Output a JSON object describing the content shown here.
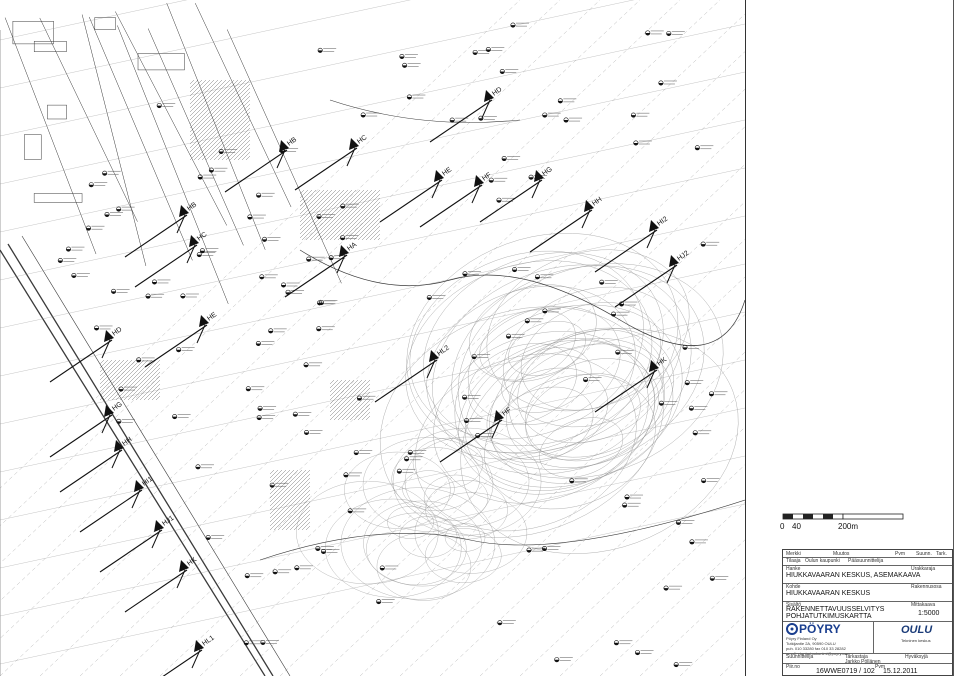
{
  "map": {
    "section_markers": [
      {
        "id": "HD",
        "angle": -35
      },
      {
        "id": "HB",
        "angle": -35
      },
      {
        "id": "HC",
        "angle": -35
      },
      {
        "id": "HE",
        "angle": -35
      },
      {
        "id": "HF",
        "angle": -35
      },
      {
        "id": "HG",
        "angle": -35
      },
      {
        "id": "HH",
        "angle": -35
      },
      {
        "id": "HI2",
        "angle": -35
      },
      {
        "id": "HJ2",
        "angle": -35
      },
      {
        "id": "HA",
        "angle": -35
      },
      {
        "id": "HB",
        "angle": -35
      },
      {
        "id": "HC",
        "angle": -35
      },
      {
        "id": "HE",
        "angle": -35
      },
      {
        "id": "HD",
        "angle": -35
      },
      {
        "id": "HL2",
        "angle": -35
      },
      {
        "id": "HK",
        "angle": -35
      },
      {
        "id": "HF",
        "angle": -35
      },
      {
        "id": "HG",
        "angle": -35
      },
      {
        "id": "HH",
        "angle": -35
      },
      {
        "id": "HI1",
        "angle": -35
      },
      {
        "id": "HJ1",
        "angle": -35
      },
      {
        "id": "HK",
        "angle": -35
      },
      {
        "id": "HL1",
        "angle": -35
      }
    ],
    "feature_colors": {
      "linework": "#3a3a3a",
      "contour": "#8a8a8a",
      "hatch": "#555555"
    }
  },
  "scale": {
    "labels": [
      "0",
      "40",
      "200m"
    ]
  },
  "title_block": {
    "header_cells": [
      "Merkki",
      "Muutos",
      "Pvm",
      "Suunn.",
      "Tark."
    ],
    "row2": [
      "Tilaaja",
      "Oulun kaupunki",
      "Pääsuunnittelija"
    ],
    "project_label": "Hanke",
    "project_name": "HIUKKAVAARAN KESKUS, ASEMAKAAVA",
    "area_label": "Kohde",
    "area_name": "HIUKKAVAARAN KESKUS",
    "content_label": "Sisältö",
    "content_line1": "RAKENNETTAVUUSSELVITYS",
    "content_line2": "POHJATUTKIMUSKARTTA",
    "scale_label": "Mittakaava",
    "scale_value": "1:5000",
    "right_labels": [
      "Urakkaraja",
      "Rakennusosa",
      "Piirustuksen numero"
    ],
    "company_name": "PÖYRY",
    "company_sub1": "Pöyry Finland Oy",
    "company_sub2": "Tutkijantie 2A, 90590 OULU",
    "company_sub3": "puh. 010 33280  fax 010 33 28282",
    "company_sub4": "email: etunimi.sukunimi@poyry.com",
    "client_logo": "OULU",
    "client_sub": "Tekninen keskus",
    "bottom_labels": [
      "Suunnittelija",
      "Tarkastaja",
      "Hyväksyjä"
    ],
    "bottom_names": [
      "",
      "Jarkko Pöllänen",
      ""
    ],
    "drawing_no_label": "Piir.no",
    "drawing_no": "16WWE0719 / 102",
    "date_label": "Pvm",
    "date": "15.12.2011"
  }
}
